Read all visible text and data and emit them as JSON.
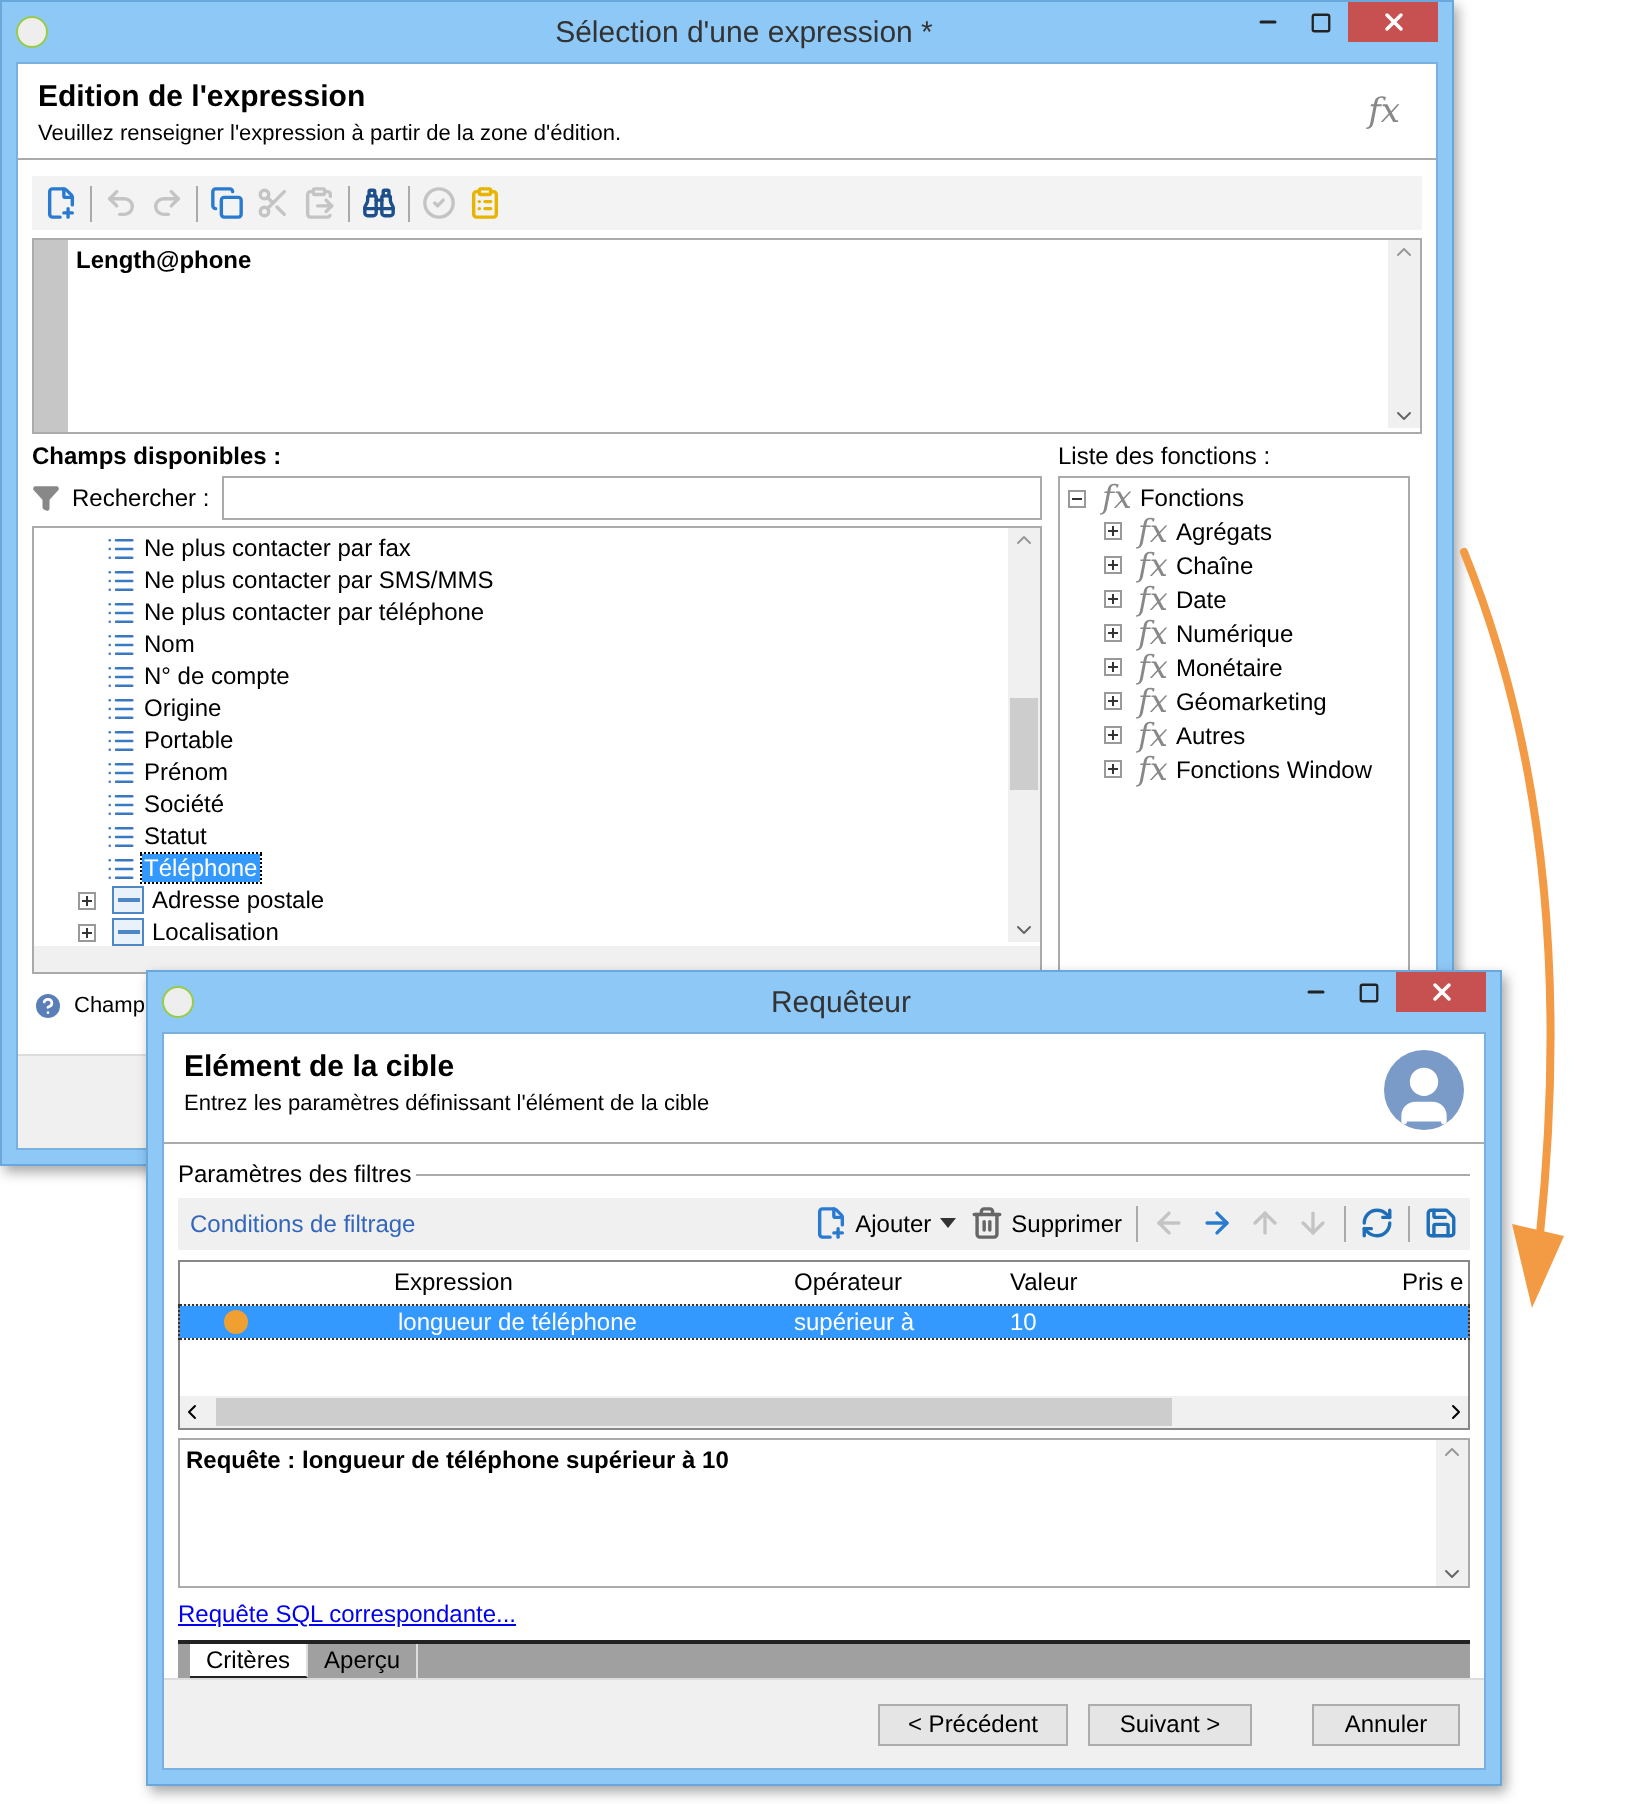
{
  "expression_window": {
    "title": "Sélection d'une expression *",
    "heading": "Edition de l'expression",
    "subtitle": "Veuillez renseigner l'expression à partir de la zone d'édition.",
    "header_glyph": "fx",
    "toolbar": [
      [
        {
          "kind": "new",
          "disabled": false
        }
      ],
      [
        {
          "kind": "undo",
          "disabled": true
        },
        {
          "kind": "redo",
          "disabled": true
        }
      ],
      [
        {
          "kind": "copy",
          "disabled": false
        },
        {
          "kind": "cut",
          "disabled": true
        },
        {
          "kind": "paste",
          "disabled": true
        }
      ],
      [
        {
          "kind": "find",
          "disabled": false
        }
      ],
      [
        {
          "kind": "validate",
          "disabled": true
        },
        {
          "kind": "clipboard",
          "disabled": false
        }
      ]
    ],
    "expression": "Length@phone",
    "fields_label": "Champs disponibles :",
    "search_label": "Rechercher :",
    "fields": [
      {
        "label": "Ne plus contacter par fax",
        "kind": "field",
        "selected": false
      },
      {
        "label": "Ne plus contacter par SMS/MMS",
        "kind": "field",
        "selected": false
      },
      {
        "label": "Ne plus contacter par téléphone",
        "kind": "field",
        "selected": false
      },
      {
        "label": "Nom",
        "kind": "field",
        "selected": false
      },
      {
        "label": "N° de compte",
        "kind": "field",
        "selected": false
      },
      {
        "label": "Origine",
        "kind": "field",
        "selected": false
      },
      {
        "label": "Portable",
        "kind": "field",
        "selected": false
      },
      {
        "label": "Prénom",
        "kind": "field",
        "selected": false
      },
      {
        "label": "Société",
        "kind": "field",
        "selected": false
      },
      {
        "label": "Statut",
        "kind": "field",
        "selected": false
      },
      {
        "label": "Téléphone",
        "kind": "field",
        "selected": true
      },
      {
        "label": "Adresse postale",
        "kind": "group",
        "expanded": false,
        "selected": false
      },
      {
        "label": "Localisation",
        "kind": "group",
        "expanded": false,
        "selected": false
      }
    ],
    "functions_label": "Liste des fonctions :",
    "functions": {
      "label": "Fonctions",
      "glyph": "fx",
      "expanded": true,
      "children": [
        {
          "label": "Agrégats",
          "glyph": "fx",
          "expanded": false
        },
        {
          "label": "Chaîne",
          "glyph": "fx",
          "expanded": false
        },
        {
          "label": "Date",
          "glyph": "fx",
          "expanded": false
        },
        {
          "label": "Numérique",
          "glyph": "fx",
          "expanded": false
        },
        {
          "label": "Monétaire",
          "glyph": "fx",
          "expanded": false
        },
        {
          "label": "Géomarketing",
          "glyph": "fx",
          "expanded": false
        },
        {
          "label": "Autres",
          "glyph": "fx",
          "expanded": false
        },
        {
          "label": "Fonctions Window",
          "glyph": "fx",
          "expanded": false
        }
      ]
    },
    "help_text": "Champ"
  },
  "query_window": {
    "title": "Requêteur",
    "heading": "Elément de la cible",
    "subtitle": "Entrez les paramètres définissant l'élément de la cible",
    "group_label": "Paramètres des filtres",
    "conditions_link": "Conditions de filtrage",
    "toolbar": [
      [
        {
          "kind": "add",
          "label": "Ajouter",
          "disabled": false
        },
        {
          "kind": "delete",
          "label": "Supprimer",
          "disabled": false
        }
      ],
      [
        {
          "kind": "left",
          "disabled": true
        },
        {
          "kind": "right",
          "disabled": false
        },
        {
          "kind": "up",
          "disabled": true
        },
        {
          "kind": "down",
          "disabled": true
        }
      ],
      [
        {
          "kind": "filter",
          "disabled": false
        }
      ],
      [
        {
          "kind": "save",
          "disabled": false
        }
      ]
    ],
    "columns": [
      "Expression",
      "Opérateur",
      "Valeur",
      "Pris e"
    ],
    "rows": [
      {
        "color": "#f0a030",
        "expression": "longueur de téléphone",
        "operator": "supérieur à",
        "value": "10",
        "selected": true
      }
    ],
    "query_text": "Requête : longueur de téléphone supérieur à 10",
    "sql_link": "Requête SQL correspondante...",
    "tabs": [
      {
        "label": "Critères",
        "selected": true
      },
      {
        "label": "Aperçu",
        "selected": false
      }
    ],
    "buttons": [
      "< Précédent",
      "Suivant >",
      "Annuler"
    ]
  }
}
